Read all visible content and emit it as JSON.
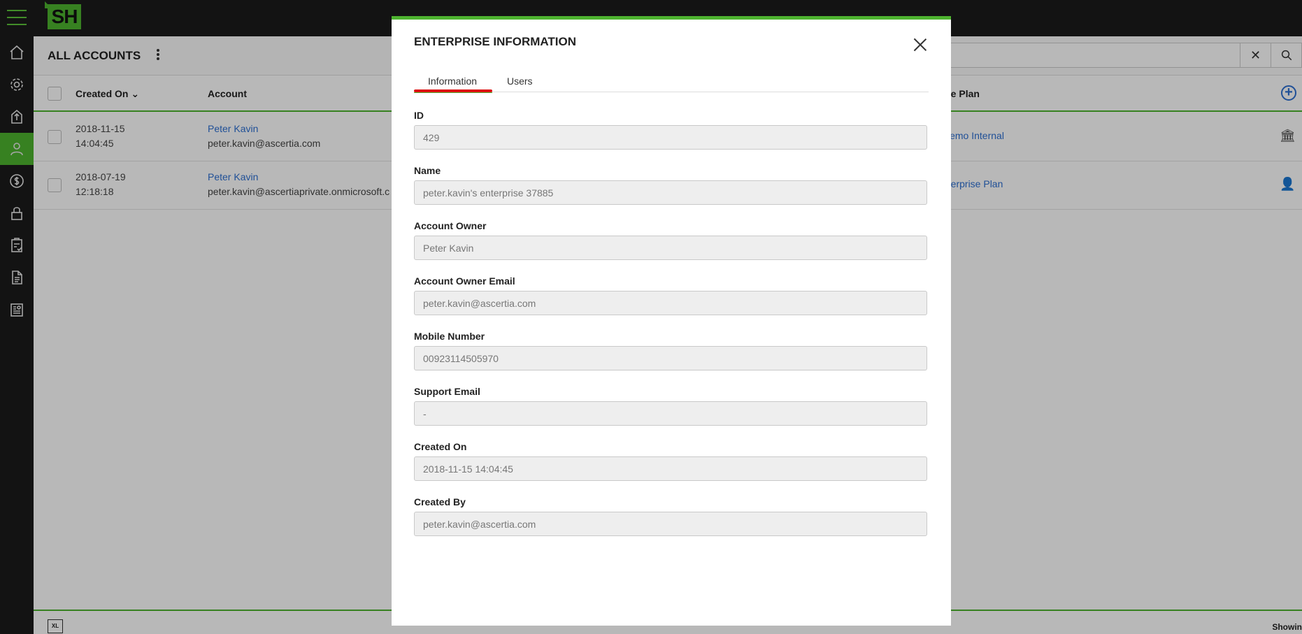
{
  "app": {
    "logo_text": "SH"
  },
  "sidebar": {
    "items": [
      {
        "icon": "home-icon"
      },
      {
        "icon": "gear-icon"
      },
      {
        "icon": "upload-icon"
      },
      {
        "icon": "user-icon",
        "active": true
      },
      {
        "icon": "dollar-icon"
      },
      {
        "icon": "lock-icon"
      },
      {
        "icon": "clipboard-check-icon"
      },
      {
        "icon": "document-icon"
      },
      {
        "icon": "report-icon"
      }
    ]
  },
  "page": {
    "title": "ALL ACCOUNTS",
    "columns": {
      "created_on": "Created On",
      "account": "Account",
      "service_plan": "ice Plan"
    },
    "rows": [
      {
        "date": "2018-11-15",
        "time": "14:04:45",
        "name": "Peter Kavin",
        "email": "peter.kavin@ascertia.com",
        "plan": "Demo Internal"
      },
      {
        "date": "2018-07-19",
        "time": "12:18:18",
        "name": "Peter Kavin",
        "email": "peter.kavin@ascertiaprivate.onmicrosoft.c",
        "plan": "nterprise Plan"
      }
    ],
    "footer": {
      "export_label": "XL",
      "showing": "Showin"
    }
  },
  "modal": {
    "title": "ENTERPRISE INFORMATION",
    "tabs": [
      {
        "label": "Information",
        "active": true
      },
      {
        "label": "Users",
        "active": false
      }
    ],
    "fields": [
      {
        "label": "ID",
        "value": "429"
      },
      {
        "label": "Name",
        "value": "peter.kavin's enterprise 37885"
      },
      {
        "label": "Account Owner",
        "value": "Peter Kavin"
      },
      {
        "label": "Account Owner Email",
        "value": "peter.kavin@ascertia.com"
      },
      {
        "label": "Mobile Number",
        "value": "00923114505970"
      },
      {
        "label": "Support Email",
        "value": "-"
      },
      {
        "label": "Created On",
        "value": "2018-11-15 14:04:45"
      },
      {
        "label": "Created By",
        "value": "peter.kavin@ascertia.com"
      }
    ]
  },
  "colors": {
    "accent": "#4db32f",
    "link": "#2d6fd1",
    "tab_indicator": "#dd1111"
  }
}
